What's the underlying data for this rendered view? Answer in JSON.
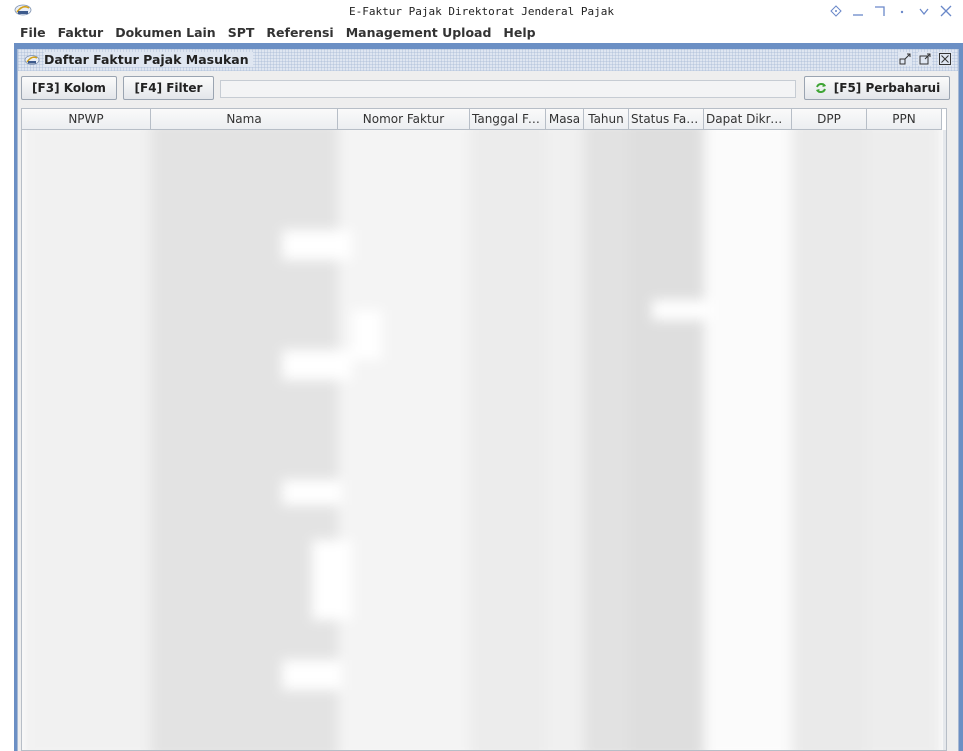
{
  "window": {
    "title": "E-Faktur Pajak Direktorat Jenderal Pajak"
  },
  "menu": [
    {
      "label": "File",
      "name": "menu-file"
    },
    {
      "label": "Faktur",
      "name": "menu-faktur"
    },
    {
      "label": "Dokumen Lain",
      "name": "menu-dokumen-lain"
    },
    {
      "label": "SPT",
      "name": "menu-spt"
    },
    {
      "label": "Referensi",
      "name": "menu-referensi"
    },
    {
      "label": "Management Upload",
      "name": "menu-management-upload"
    },
    {
      "label": "Help",
      "name": "menu-help"
    }
  ],
  "internal_frame": {
    "title": "Daftar Faktur Pajak Masukan"
  },
  "toolbar": {
    "kolom_label": "[F3] Kolom",
    "filter_label": "[F4] Filter",
    "filter_value": "",
    "refresh_label": "[F5] Perbaharui"
  },
  "table": {
    "columns": [
      "NPWP",
      "Nama",
      "Nomor Faktur",
      "Tanggal Fa...",
      "Masa",
      "Tahun",
      "Status Faktur",
      "Dapat Dikredi...",
      "DPP",
      "PPN"
    ],
    "rows_obscured": true
  },
  "colors": {
    "desktop_background": "#6b8fc4",
    "refresh_icon": "#3fa535",
    "frame_title_background": "#dfe6f1"
  },
  "icons": {
    "app": "efaktur-logo-icon",
    "frame": "efaktur-logo-icon",
    "refresh": "refresh-icon"
  }
}
